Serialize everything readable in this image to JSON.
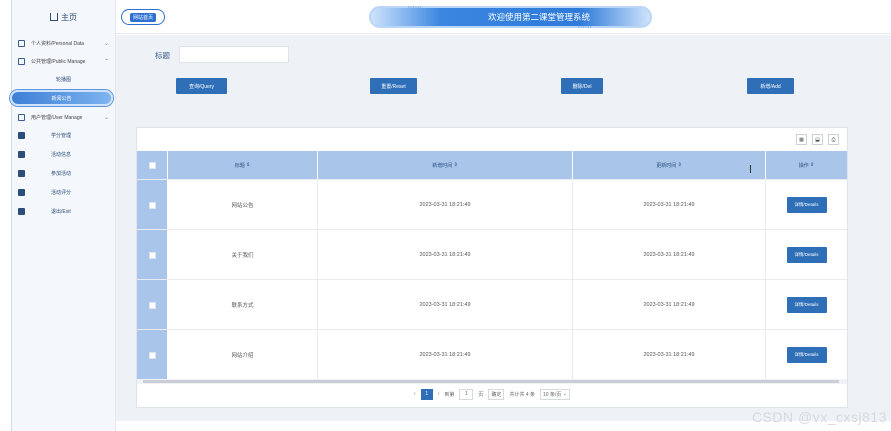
{
  "header": {
    "tag_label": "网站首页",
    "title": "欢迎使用第二课堂管理系统"
  },
  "sidebar": {
    "home_label": "主页",
    "groups": [
      {
        "label": "个人资料/Personal Data",
        "icon": "id-card-icon"
      },
      {
        "label": "公共管理/Public Manage",
        "icon": "file-icon"
      }
    ],
    "sub_items": [
      {
        "label": "轮播图"
      },
      {
        "label": "新闻公告"
      }
    ],
    "group_user": {
      "label": "用户管理/User Manage",
      "icon": "chart-icon"
    },
    "items": [
      {
        "label": "学分管理",
        "icon": "users-icon"
      },
      {
        "label": "活动信息",
        "icon": "bookmark-icon"
      },
      {
        "label": "参加活动",
        "icon": "person-icon"
      },
      {
        "label": "活动评分",
        "icon": "calendar-icon"
      },
      {
        "label": "退出/Exit",
        "icon": "exit-icon"
      }
    ]
  },
  "filter": {
    "label": "标题",
    "value": ""
  },
  "buttons": {
    "query": "查询/Query",
    "reset": "重置/Reset",
    "delete": "删除/Del",
    "add": "新增/Add"
  },
  "table": {
    "columns": [
      "标题",
      "新增时间",
      "更新时间",
      "操作"
    ],
    "detail_label": "详情/Details",
    "rows": [
      {
        "title": "网站公告",
        "created": "2023-03-31 18:21:49",
        "updated": "2023-03-31 18:21:49"
      },
      {
        "title": "关于我们",
        "created": "2023-03-31 18:21:49",
        "updated": "2023-03-31 18:21:49"
      },
      {
        "title": "联系方式",
        "created": "2023-03-31 18:21:49",
        "updated": "2023-03-31 18:21:49"
      },
      {
        "title": "网站介绍",
        "created": "2023-03-31 18:21:49",
        "updated": "2023-03-31 18:21:49"
      }
    ]
  },
  "pager": {
    "current": "1",
    "goto_prefix": "到第",
    "goto_value": "1",
    "goto_suffix": "页",
    "confirm": "确定",
    "total": "共计共 4 条",
    "page_size": "10 条/页"
  },
  "watermark": "CSDN @vx_cxsj813",
  "colors": {
    "primary": "#2e6fb8",
    "header_row": "#a9c6ea",
    "background": "#eef1f6"
  }
}
